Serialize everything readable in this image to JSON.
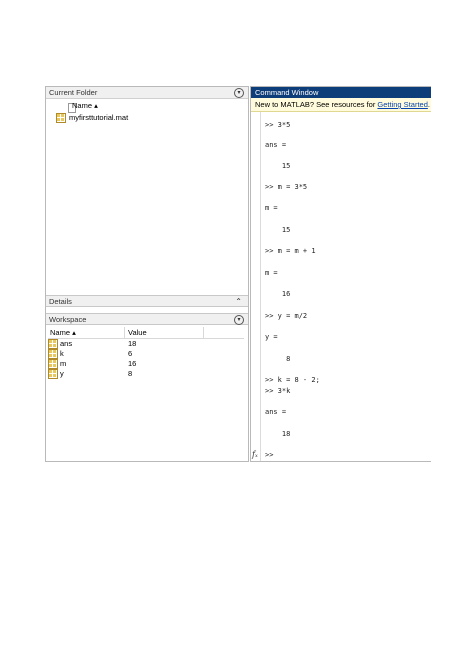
{
  "current_folder": {
    "title": "Current Folder",
    "column_name": "Name ▴",
    "files": [
      {
        "name": "myfirsttutorial.mat"
      }
    ]
  },
  "details": {
    "title": "Details"
  },
  "workspace": {
    "title": "Workspace",
    "columns": {
      "name": "Name ▴",
      "value": "Value"
    },
    "variables": [
      {
        "name": "ans",
        "value": "18"
      },
      {
        "name": "k",
        "value": "6"
      },
      {
        "name": "m",
        "value": "16"
      },
      {
        "name": "y",
        "value": "8"
      }
    ]
  },
  "command_window": {
    "title": "Command Window",
    "banner_text": "New to MATLAB? See resources for ",
    "banner_link": "Getting Started",
    "banner_end": ".",
    "lines": [
      ">> 3*5",
      "ans =",
      "    15",
      ">> m = 3*5",
      "m =",
      "    15",
      ">> m = m + 1",
      "m =",
      "    16",
      ">> y = m/2",
      "y =",
      "     8",
      ">> k = 8 - 2;",
      ">> 3*k",
      "ans =",
      "    18"
    ],
    "prompt_icon": "fx-icon",
    "prompt": ">>"
  }
}
